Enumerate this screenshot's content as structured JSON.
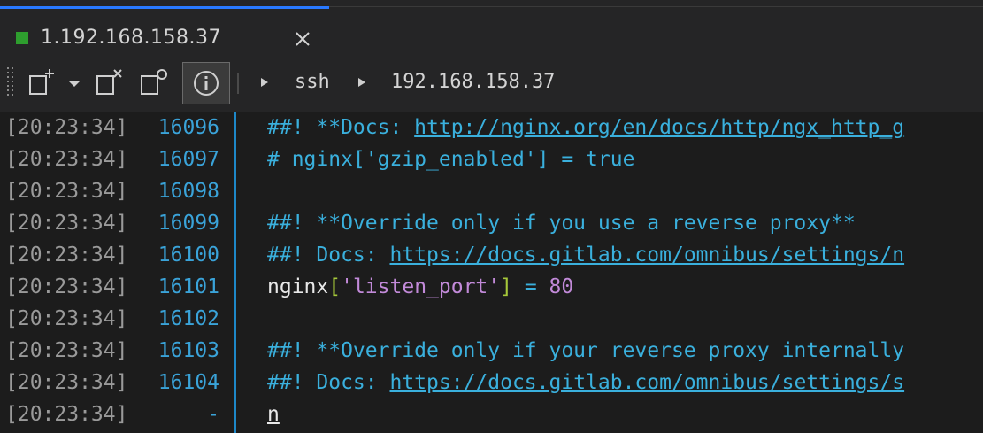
{
  "tab": {
    "title": "1.192.168.158.37",
    "status_color": "#2e9e2e",
    "accent_color": "#2979ff",
    "close_icon": "close-icon"
  },
  "toolbar": {
    "icons": [
      "grip-icon",
      "new-tab-icon",
      "dropdown-arrow-icon",
      "close-tab-icon",
      "split-icon",
      "info-icon"
    ],
    "breadcrumb": [
      "ssh",
      "192.168.158.37"
    ]
  },
  "terminal": {
    "rows": [
      {
        "ts": "[20:23:34]",
        "ln": "16096",
        "segments": [
          [
            "c-comment",
            "##! **Docs: "
          ],
          [
            "c-link",
            "http://nginx.org/en/docs/http/ngx_http_g"
          ]
        ]
      },
      {
        "ts": "[20:23:34]",
        "ln": "16097",
        "segments": [
          [
            "c-comment",
            "# nginx['gzip_enabled'] = true"
          ]
        ]
      },
      {
        "ts": "[20:23:34]",
        "ln": "16098",
        "segments": []
      },
      {
        "ts": "[20:23:34]",
        "ln": "16099",
        "segments": [
          [
            "c-comment",
            "##! **Override only if you use a reverse proxy**"
          ]
        ]
      },
      {
        "ts": "[20:23:34]",
        "ln": "16100",
        "segments": [
          [
            "c-comment",
            "##! Docs: "
          ],
          [
            "c-link",
            "https://docs.gitlab.com/omnibus/settings/n"
          ]
        ]
      },
      {
        "ts": "[20:23:34]",
        "ln": "16101",
        "segments": [
          [
            "c-white",
            "nginx"
          ],
          [
            "c-bracket",
            "["
          ],
          [
            "c-string",
            "'listen_port'"
          ],
          [
            "c-bracket",
            "]"
          ],
          [
            "c-op",
            " = "
          ],
          [
            "c-num",
            "80"
          ]
        ]
      },
      {
        "ts": "[20:23:34]",
        "ln": "16102",
        "segments": []
      },
      {
        "ts": "[20:23:34]",
        "ln": "16103",
        "segments": [
          [
            "c-comment",
            "##! **Override only if your reverse proxy internally"
          ]
        ]
      },
      {
        "ts": "[20:23:34]",
        "ln": "16104",
        "segments": [
          [
            "c-comment",
            "##! Docs: "
          ],
          [
            "c-link",
            "https://docs.gitlab.com/omnibus/settings/s"
          ]
        ]
      },
      {
        "ts": "[20:23:34]",
        "ln": "-",
        "segments": [
          [
            "c-n",
            "n"
          ]
        ]
      }
    ]
  }
}
